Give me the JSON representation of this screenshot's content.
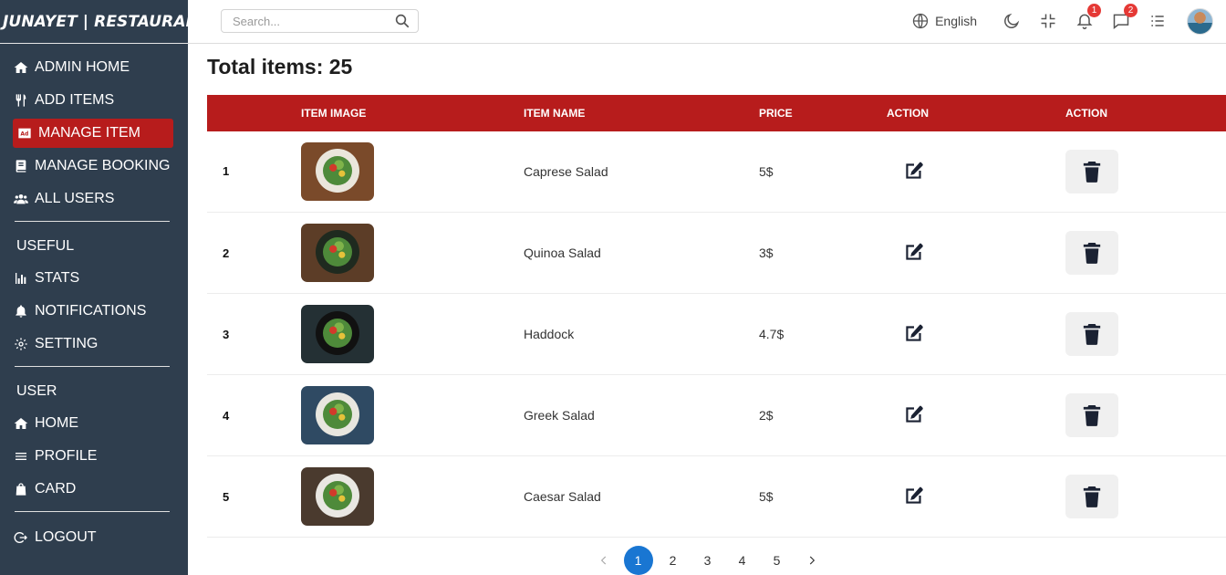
{
  "brand": "JUNAYET | RESTAURANT",
  "sidebar": {
    "admin": [
      {
        "label": "ADMIN HOME",
        "icon": "home-icon"
      },
      {
        "label": "ADD ITEMS",
        "icon": "utensils-icon"
      },
      {
        "label": "MANAGE ITEM",
        "icon": "ad-icon",
        "active": true
      },
      {
        "label": "MANAGE BOOKING",
        "icon": "book-icon"
      },
      {
        "label": "ALL USERS",
        "icon": "users-icon"
      }
    ],
    "useful_title": "USEFUL",
    "useful": [
      {
        "label": "STATS",
        "icon": "bar-chart-icon"
      },
      {
        "label": "NOTIFICATIONS",
        "icon": "bell-icon"
      },
      {
        "label": "SETTING",
        "icon": "gear-icon"
      }
    ],
    "user_title": "USER",
    "user": [
      {
        "label": "HOME",
        "icon": "home-icon"
      },
      {
        "label": "PROFILE",
        "icon": "menu-icon"
      },
      {
        "label": "CARD",
        "icon": "shopping-bag-icon"
      }
    ],
    "logout": "LOGOUT"
  },
  "topbar": {
    "search_placeholder": "Search...",
    "language": "English",
    "notifications_count": "1",
    "messages_count": "2"
  },
  "main": {
    "total_label": "Total items: 25"
  },
  "table": {
    "headers": [
      "",
      "ITEM IMAGE",
      "ITEM NAME",
      "PRICE",
      "ACTION",
      "ACTION"
    ],
    "rows": [
      {
        "num": "1",
        "name": "Caprese Salad",
        "price": "5$",
        "bg": "#7a4a2a",
        "plate": "#eae6dc"
      },
      {
        "num": "2",
        "name": "Quinoa Salad",
        "price": "3$",
        "bg": "#5c3d27",
        "plate": "#1f2a1f"
      },
      {
        "num": "3",
        "name": "Haddock",
        "price": "4.7$",
        "bg": "#243034",
        "plate": "#111111"
      },
      {
        "num": "4",
        "name": "Greek Salad",
        "price": "2$",
        "bg": "#2f4a63",
        "plate": "#e8e6df"
      },
      {
        "num": "5",
        "name": "Caesar Salad",
        "price": "5$",
        "bg": "#4a3a2e",
        "plate": "#e9e7e2"
      }
    ]
  },
  "pagination": {
    "pages": [
      "1",
      "2",
      "3",
      "4",
      "5"
    ],
    "current": "1"
  },
  "colors": {
    "sidebar": "#2f3e4e",
    "accent": "#b71c1c",
    "pagination_active": "#1976d2"
  }
}
